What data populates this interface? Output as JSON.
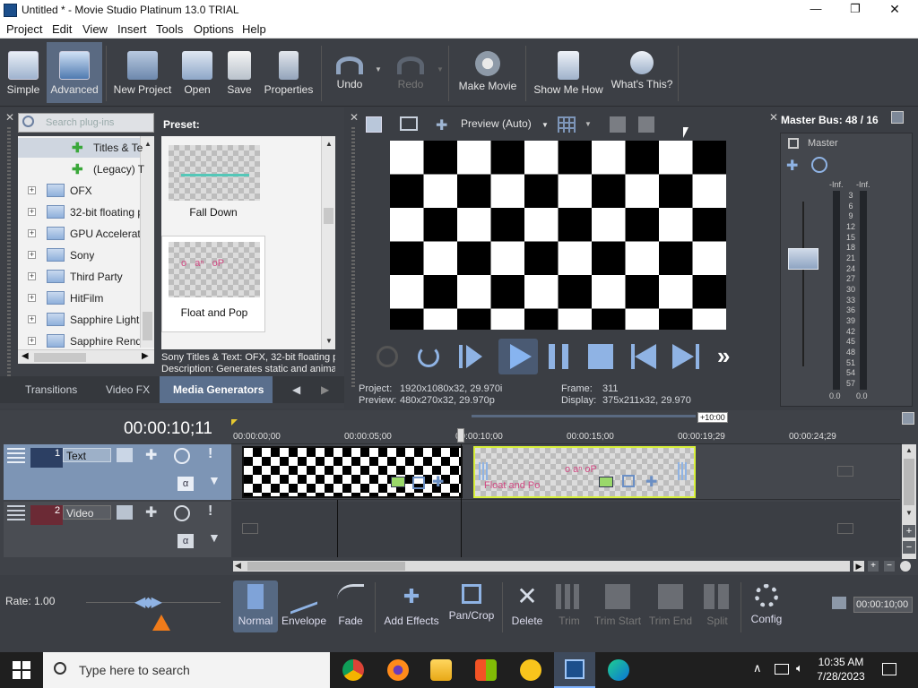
{
  "window": {
    "title": "Untitled * - Movie Studio Platinum 13.0 TRIAL",
    "min": "—",
    "max": "❐",
    "close": "✕"
  },
  "menu": [
    "Project",
    "Edit",
    "View",
    "Insert",
    "Tools",
    "Options",
    "Help"
  ],
  "toolbar": {
    "simple": "Simple",
    "advanced": "Advanced",
    "new_project": "New Project",
    "open": "Open",
    "save": "Save",
    "properties": "Properties",
    "undo": "Undo",
    "redo": "Redo",
    "make_movie": "Make Movie",
    "show_me_how": "Show Me How",
    "whats_this": "What's This?"
  },
  "plugins": {
    "search_placeholder": "Search plug-ins",
    "tree": [
      "Titles & Te",
      "(Legacy) T",
      "OFX",
      "32-bit floating p",
      "GPU Accelerated",
      "Sony",
      "Third Party",
      "HitFilm",
      "Sapphire Lightin",
      "Sapphire Rende"
    ],
    "preset_label": "Preset:",
    "presets": [
      "Fall Down",
      "Float and Pop"
    ],
    "desc_line1": "Sony Titles & Text: OFX, 32-bit floating p",
    "desc_line2": "Description: Generates static and anima",
    "tabs": [
      "Transitions",
      "Video FX",
      "Media Generators"
    ]
  },
  "preview": {
    "mode": "Preview (Auto)",
    "project_label": "Project:",
    "project_value": "1920x1080x32, 29.970i",
    "preview_label": "Preview:",
    "preview_value": "480x270x32, 29.970p",
    "frame_label": "Frame:",
    "frame_value": "311",
    "display_label": "Display:",
    "display_value": "375x211x32, 29.970"
  },
  "masterbus": {
    "title": "Master Bus: 48 / 16",
    "master": "Master",
    "inf_left": "-Inf.",
    "inf_right": "-Inf.",
    "scale": [
      "3",
      "6",
      "9",
      "12",
      "15",
      "18",
      "21",
      "24",
      "27",
      "30",
      "33",
      "36",
      "39",
      "42",
      "45",
      "48",
      "51",
      "54",
      "57"
    ],
    "zero_left": "0.0",
    "zero_right": "0.0"
  },
  "timeline": {
    "timecode": "00:00:10;11",
    "offset": "+10:00",
    "rulers": [
      "00:00:00;00",
      "00:00:05;00",
      "00:00:10;00",
      "00:00:15;00",
      "00:00:19;29",
      "00:00:24;29"
    ],
    "track1": {
      "num": "1",
      "name": "Text"
    },
    "track2": {
      "num": "2",
      "name": "Video"
    },
    "clip_label": "Float and Po",
    "clip_pop": "o aⁿ oP"
  },
  "bottom": {
    "rate": "Rate: 1.00",
    "normal": "Normal",
    "envelope": "Envelope",
    "fade": "Fade",
    "add_effects": "Add Effects",
    "pan_crop": "Pan/Crop",
    "delete": "Delete",
    "trim": "Trim",
    "trim_start": "Trim Start",
    "trim_end": "Trim End",
    "split": "Split",
    "config": "Config",
    "end_time": "00:00:10;00"
  },
  "taskbar": {
    "search_placeholder": "Type here to search",
    "time": "10:35 AM",
    "date": "7/28/2023"
  }
}
